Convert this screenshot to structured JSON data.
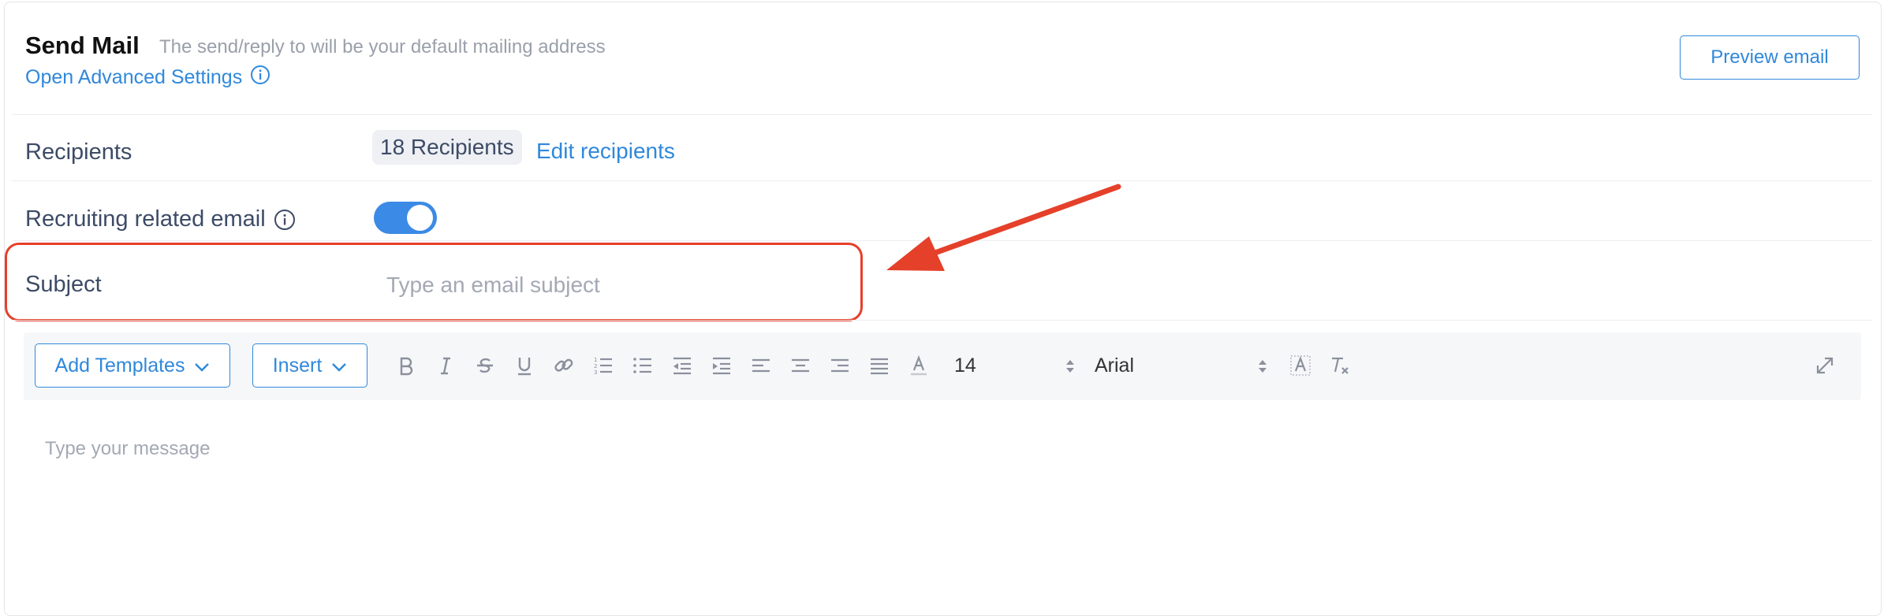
{
  "header": {
    "title": "Send Mail",
    "subtitle": "The send/reply to will be your default mailing address",
    "advanced_link": "Open Advanced Settings",
    "preview_button": "Preview email"
  },
  "recipients": {
    "label": "Recipients",
    "count_chip": "18 Recipients",
    "edit_link": "Edit recipients"
  },
  "recruiting": {
    "label": "Recruiting related email",
    "toggle_on": true
  },
  "subject": {
    "label": "Subject",
    "placeholder": "Type an email subject",
    "value": ""
  },
  "toolbar": {
    "add_templates": "Add Templates",
    "insert": "Insert",
    "font_size": "14",
    "font_family": "Arial",
    "icons": [
      "bold-icon",
      "italic-icon",
      "strikethrough-icon",
      "underline-icon",
      "link-icon",
      "ordered-list-icon",
      "bullet-list-icon",
      "outdent-icon",
      "indent-icon",
      "align-left-icon",
      "align-center-icon",
      "align-right-icon",
      "align-justify-icon",
      "text-color-icon",
      "background-color-icon",
      "clear-format-icon",
      "expand-icon"
    ]
  },
  "editor": {
    "placeholder": "Type your message"
  },
  "colors": {
    "accent": "#2f88db",
    "toggle": "#3b8ae6",
    "annotation": "#e5402a"
  }
}
